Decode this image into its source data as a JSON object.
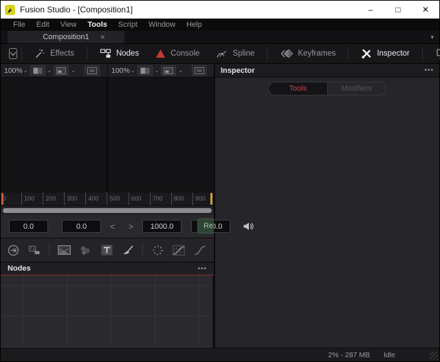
{
  "window": {
    "title": "Fusion Studio - [Composition1]",
    "minimize": "–",
    "maximize": "□",
    "close": "✕"
  },
  "menu": {
    "items": [
      {
        "label": "File"
      },
      {
        "label": "Edit"
      },
      {
        "label": "View"
      },
      {
        "label": "Tools",
        "active": true
      },
      {
        "label": "Script"
      },
      {
        "label": "Window"
      },
      {
        "label": "Help"
      }
    ]
  },
  "tabs": {
    "active_tab": "Composition1",
    "close_glyph": "✕",
    "overflow_glyph": "▾"
  },
  "toolbar": {
    "effects": "Effects",
    "nodes": "Nodes",
    "console": "Console",
    "spline": "Spline",
    "keyframes": "Keyframes",
    "inspector": "Inspector",
    "icons": {
      "view_toggle": "box-chevron-down",
      "effects": "magic-wand",
      "nodes": "node-graph",
      "console": "warning-triangle",
      "spline": "spline-curve",
      "keyframes": "stacked-diamonds",
      "inspector": "crossed-tools",
      "external_monitor": "monitor-chevron"
    }
  },
  "viewers": {
    "left_zoom": "100%",
    "right_zoom": "100%",
    "chevron_glyph": "⌄"
  },
  "timeline": {
    "ticks": [
      "0",
      "100",
      "200",
      "300",
      "400",
      "500",
      "600",
      "700",
      "800",
      "900"
    ],
    "marker_left_color": "#c75a3a",
    "marker_right_color": "#d2a13c"
  },
  "transport": {
    "global_start": "0.0",
    "range_start": "0.0",
    "prev_glyph": "<",
    "next_glyph": ">",
    "range_end": "1000.0",
    "global_end": "1000.0",
    "render_label": "Render"
  },
  "shelf": {
    "icons": [
      "loader",
      "saver",
      "background",
      "fastnoise",
      "text-plus",
      "paint",
      "particles",
      "color-curves",
      "color-corrector"
    ]
  },
  "nodes_panel": {
    "title": "Nodes",
    "menu_glyph": "•••"
  },
  "inspector": {
    "title": "Inspector",
    "menu_glyph": "•••",
    "tab_tools": "Tools",
    "tab_modifiers": "Modifiers",
    "accent_red": "#c94540"
  },
  "status": {
    "memory": "2% - 287 MB",
    "state": "Idle"
  }
}
